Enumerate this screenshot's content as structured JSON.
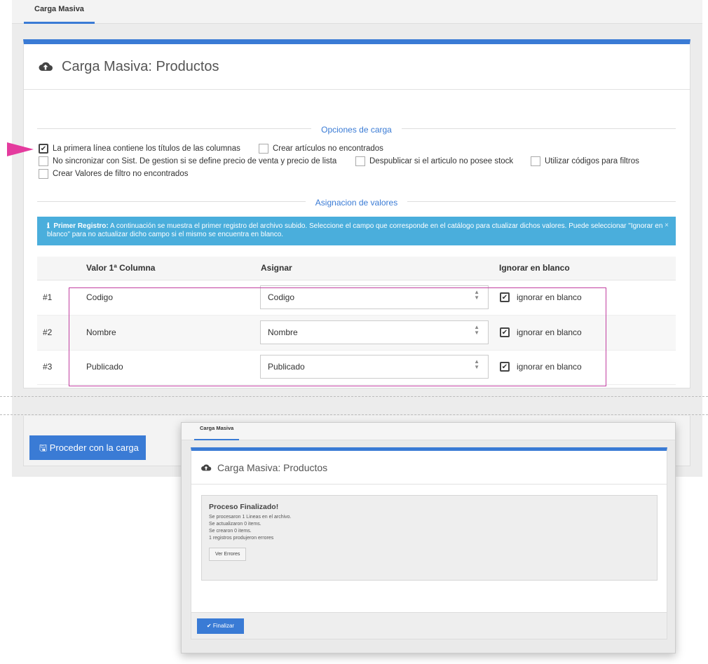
{
  "tab": {
    "label": "Carga Masiva"
  },
  "panel": {
    "title": "Carga Masiva: Productos"
  },
  "sections": {
    "options": "Opciones de carga",
    "assign": "Asignacion de valores"
  },
  "options": [
    {
      "label": "La primera línea contiene los títulos de las columnas",
      "checked": true
    },
    {
      "label": "Crear artículos no encontrados",
      "checked": false
    },
    {
      "label": "No sincronizar con Sist. De gestion si se define precio de venta y precio de lista",
      "checked": false
    },
    {
      "label": "Despublicar si el articulo no posee stock",
      "checked": false
    },
    {
      "label": "Utilizar códigos para filtros",
      "checked": false
    },
    {
      "label": "Crear Valores de filtro no encontrados",
      "checked": false
    }
  ],
  "alert": {
    "icon": "info-icon",
    "title": "Primer Registro:",
    "text": "A continuación se muestra el primer registro del archivo subido. Seleccione el campo que corresponde en el catálogo para ctualizar dichos valores. Puede seleccionar \"Ignorar en blanco\" para no actualizar dicho campo si el mismo se encuentra en blanco.",
    "close": "×"
  },
  "table": {
    "headers": [
      "Valor 1ª Columna",
      "Asignar",
      "Ignorar en blanco"
    ],
    "rows": [
      {
        "num": "#1",
        "value": "Codigo",
        "assign": "Codigo",
        "ignore": "ignorar en blanco"
      },
      {
        "num": "#2",
        "value": "Nombre",
        "assign": "Nombre",
        "ignore": "ignorar en blanco"
      },
      {
        "num": "#3",
        "value": "Publicado",
        "assign": "Publicado",
        "ignore": "ignorar en blanco"
      }
    ]
  },
  "footer": {
    "proceed": "Proceder con la carga"
  },
  "popup": {
    "tab": "Carga Masiva",
    "title": "Carga Masiva: Productos",
    "result_title": "Proceso Finalizado!",
    "lines": [
      "Se procesaron 1 Lineas en el archivo.",
      "Se actualizaron 0 items.",
      "Se crearon 0 items.",
      "1 registros produjeron errores"
    ],
    "errors_button": "Ver Errores",
    "finish_button": "Finalizar"
  },
  "colors": {
    "accent": "#3a7bd5",
    "alert": "#4aaedc",
    "highlight": "#c13fa0",
    "pointer": "#e43b9e"
  }
}
